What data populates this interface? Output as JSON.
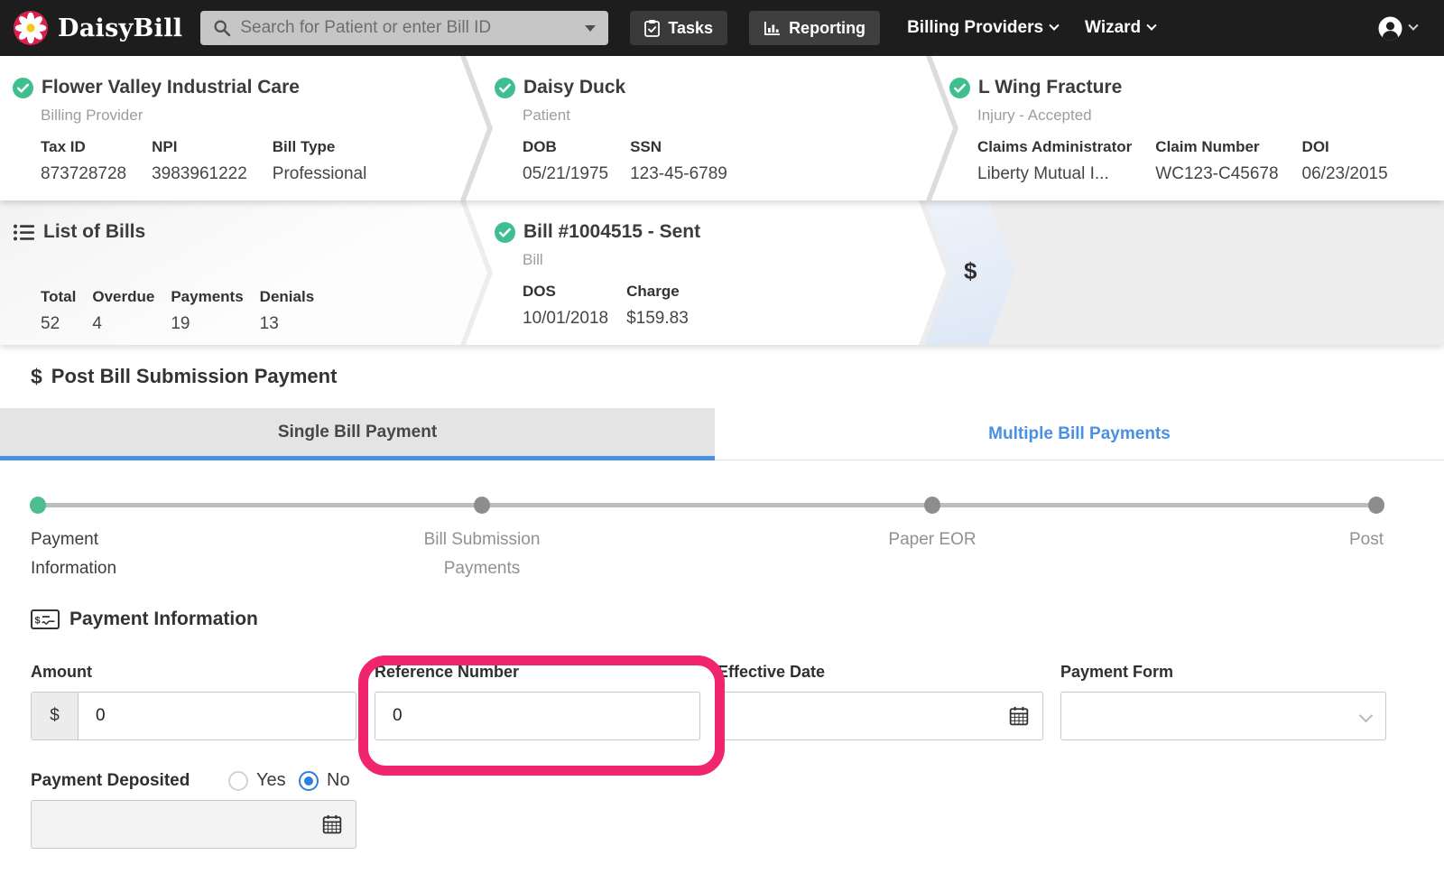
{
  "navbar": {
    "brand": "DaisyBill",
    "search_placeholder": "Search for Patient or enter Bill ID",
    "tasks_label": "Tasks",
    "reporting_label": "Reporting",
    "billing_providers_label": "Billing Providers",
    "wizard_label": "Wizard"
  },
  "breadcrumbs": {
    "provider": {
      "title": "Flower Valley Industrial Care",
      "subtitle": "Billing Provider",
      "fields": [
        {
          "label": "Tax ID",
          "value": "873728728"
        },
        {
          "label": "NPI",
          "value": "3983961222"
        },
        {
          "label": "Bill Type",
          "value": "Professional"
        }
      ]
    },
    "patient": {
      "title": "Daisy Duck",
      "subtitle": "Patient",
      "fields": [
        {
          "label": "DOB",
          "value": "05/21/1975"
        },
        {
          "label": "SSN",
          "value": "123-45-6789"
        }
      ]
    },
    "injury": {
      "title": "L Wing Fracture",
      "subtitle": "Injury - Accepted",
      "fields": [
        {
          "label": "Claims Administrator",
          "value": "Liberty Mutual I..."
        },
        {
          "label": "Claim Number",
          "value": "WC123-C45678"
        },
        {
          "label": "DOI",
          "value": "06/23/2015"
        }
      ]
    },
    "bills_list": {
      "title": "List of Bills",
      "fields": [
        {
          "label": "Total",
          "value": "52"
        },
        {
          "label": "Overdue",
          "value": "4"
        },
        {
          "label": "Payments",
          "value": "19"
        },
        {
          "label": "Denials",
          "value": "13"
        }
      ]
    },
    "bill": {
      "title": "Bill #1004515 - Sent",
      "subtitle": "Bill",
      "fields": [
        {
          "label": "DOS",
          "value": "10/01/2018"
        },
        {
          "label": "Charge",
          "value": "$159.83"
        }
      ]
    },
    "payment_chevron_glyph": "$"
  },
  "section": {
    "icon_glyph": "$",
    "title": "Post Bill Submission Payment"
  },
  "tabs": [
    {
      "label": "Single Bill Payment",
      "active": true
    },
    {
      "label": "Multiple Bill Payments",
      "active": false
    }
  ],
  "stepper": {
    "steps": [
      {
        "label": "Payment Information",
        "state": "active"
      },
      {
        "label": "Bill Submission Payments",
        "state": "pending"
      },
      {
        "label": "Paper EOR",
        "state": "pending"
      },
      {
        "label": "Post",
        "state": "pending"
      }
    ]
  },
  "form": {
    "heading": "Payment Information",
    "amount": {
      "label": "Amount",
      "prefix": "$",
      "value": "0"
    },
    "reference_number": {
      "label": "Reference Number",
      "value": "0"
    },
    "effective_date": {
      "label": "Effective Date",
      "value": ""
    },
    "payment_form": {
      "label": "Payment Form",
      "value": ""
    },
    "payment_deposited": {
      "label": "Payment Deposited",
      "options": [
        {
          "label": "Yes",
          "selected": false
        },
        {
          "label": "No",
          "selected": true
        }
      ],
      "deposit_date_value": ""
    }
  },
  "colors": {
    "navbar_bg": "#1d1d1d",
    "accent_blue": "#4a90e2",
    "success_green": "#3fbf90",
    "highlight_pink": "#f1256d",
    "logo_red": "#d8204c",
    "logo_yellow": "#f5c518"
  }
}
